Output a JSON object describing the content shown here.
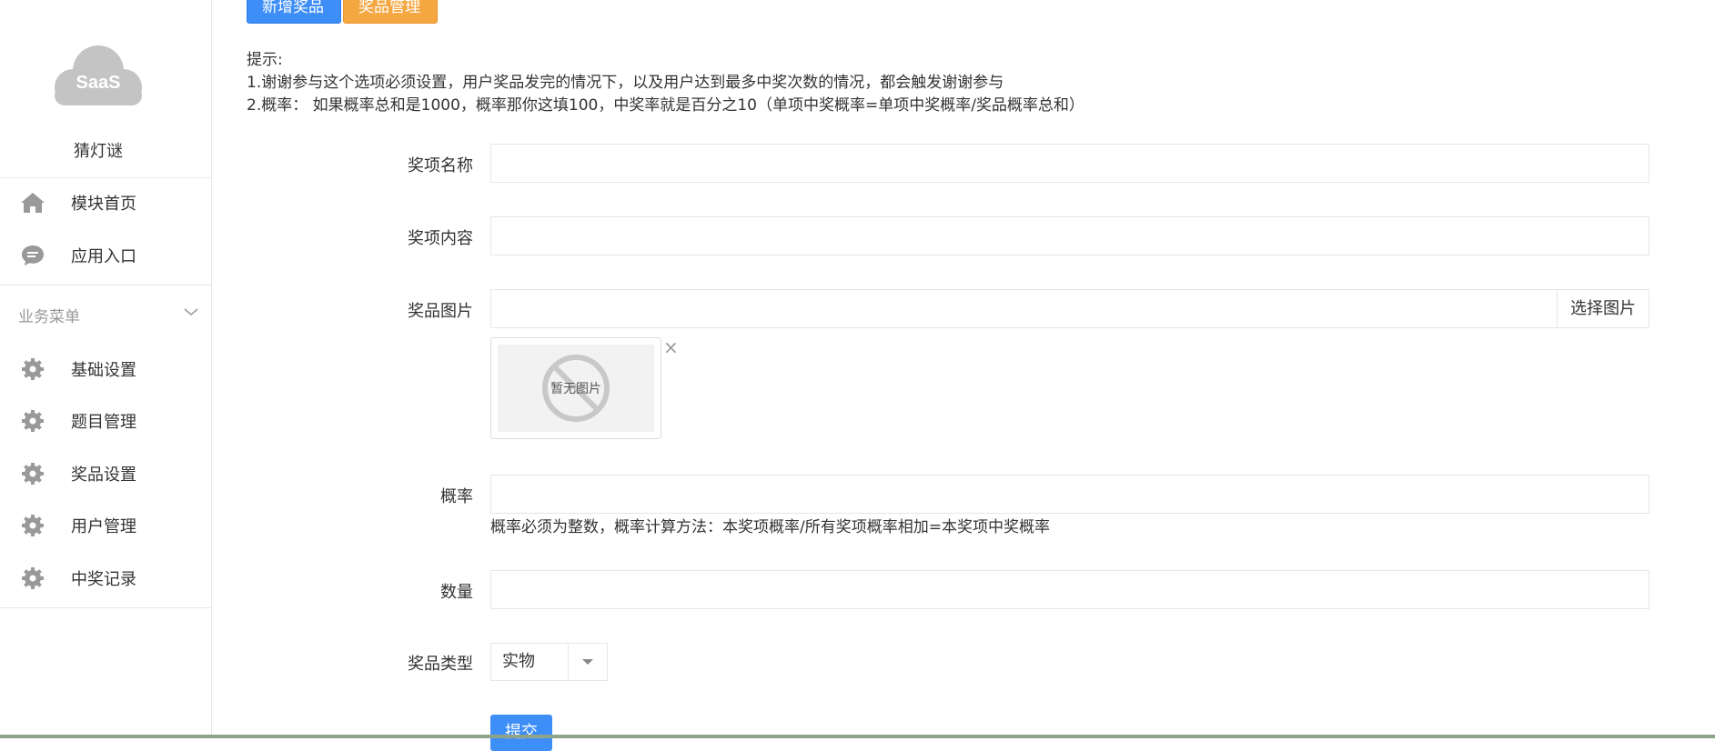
{
  "sidebar": {
    "logo_text": "SaaS",
    "app_name": "猜灯谜",
    "top_items": [
      {
        "label": "模块首页",
        "icon": "home-icon"
      },
      {
        "label": "应用入口",
        "icon": "chat-bubble-icon"
      }
    ],
    "section_title": "业务菜单",
    "business_items": [
      {
        "label": "基础设置",
        "icon": "gear-icon"
      },
      {
        "label": "题目管理",
        "icon": "gear-icon"
      },
      {
        "label": "奖品设置",
        "icon": "gear-icon"
      },
      {
        "label": "用户管理",
        "icon": "gear-icon"
      },
      {
        "label": "中奖记录",
        "icon": "gear-icon"
      }
    ]
  },
  "toolbar": {
    "add_prize_label": "新增奖品",
    "manage_prize_label": "奖品管理"
  },
  "tips": {
    "title": "提示:",
    "line1": "1.谢谢参与这个选项必须设置，用户奖品发完的情况下，以及用户达到最多中奖次数的情况，都会触发谢谢参与",
    "line2": "2.概率： 如果概率总和是1000，概率那你这填100，中奖率就是百分之10（单项中奖概率=单项中奖概率/奖品概率总和）"
  },
  "form": {
    "name_label": "奖项名称",
    "name_value": "",
    "content_label": "奖项内容",
    "content_value": "",
    "image_label": "奖品图片",
    "image_value": "",
    "choose_image_label": "选择图片",
    "no_image_text": "暂无图片",
    "close_symbol": "×",
    "probability_label": "概率",
    "probability_value": "",
    "probability_help": "概率必须为整数，概率计算方法：本奖项概率/所有奖项概率相加=本奖项中奖概率",
    "quantity_label": "数量",
    "quantity_value": "",
    "type_label": "奖品类型",
    "type_selected": "实物",
    "submit_label": "提交"
  },
  "colors": {
    "primary": "#3e8ef7",
    "warning": "#f5a742",
    "logo_gray": "#c4c4c4",
    "icon_gray": "#999999"
  }
}
